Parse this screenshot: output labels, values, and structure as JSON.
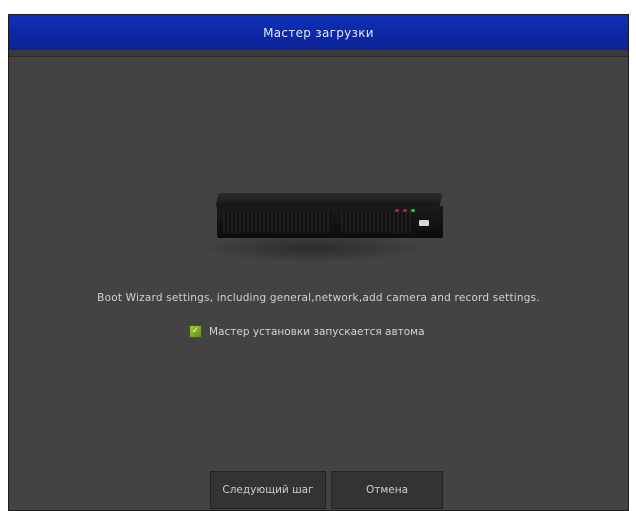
{
  "dialog": {
    "title": "Мастер загрузки",
    "description": "Boot Wizard settings, including general,network,add camera and record settings.",
    "auto_start": {
      "label": "Мастер установки запускается автома",
      "checked": true
    },
    "buttons": {
      "next": "Следующий шаг",
      "cancel": "Отмена"
    }
  },
  "colors": {
    "titlebar": "#0a2296",
    "panel": "#434343",
    "button": "#333333",
    "checkbox": "#7fb12a",
    "led_red": "#d01818",
    "led_green": "#24c030"
  }
}
